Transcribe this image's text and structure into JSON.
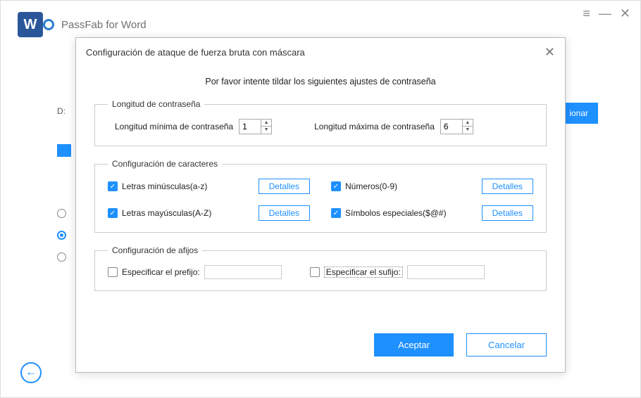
{
  "app": {
    "title": "PassFab for Word",
    "logo_letter": "W"
  },
  "titlebar": {
    "menu": "≡",
    "minimize": "—",
    "close": "✕"
  },
  "background": {
    "d_text": "D:",
    "select_btn": "ionar"
  },
  "radios": [
    {
      "checked": false
    },
    {
      "checked": true
    },
    {
      "checked": false
    }
  ],
  "back_icon": "←",
  "modal": {
    "title": "Configuración de ataque de fuerza bruta con máscara",
    "close": "✕",
    "instruction": "Por favor intente tildar los siguientes ajustes de contraseña",
    "length": {
      "legend": "Longitud de contraseña",
      "min_label": "Longitud mínima de contraseña",
      "min_value": "1",
      "max_label": "Longitud máxima de contraseña",
      "max_value": "6"
    },
    "chars": {
      "legend": "Configuración de caracteres",
      "details_label": "Detalles",
      "items": [
        {
          "label": "Letras minúsculas(a-z)",
          "checked": true
        },
        {
          "label": "Números(0-9)",
          "checked": true
        },
        {
          "label": "Letras mayúsculas(A-Z)",
          "checked": true
        },
        {
          "label": "Símbolos especiales($@#)",
          "checked": true
        }
      ]
    },
    "affix": {
      "legend": "Configuración de afijos",
      "prefix_label": "Especificar el prefijo:",
      "prefix_value": "",
      "suffix_label": "Especificar el sufijo:",
      "suffix_value": ""
    },
    "buttons": {
      "ok": "Aceptar",
      "cancel": "Cancelar"
    }
  }
}
